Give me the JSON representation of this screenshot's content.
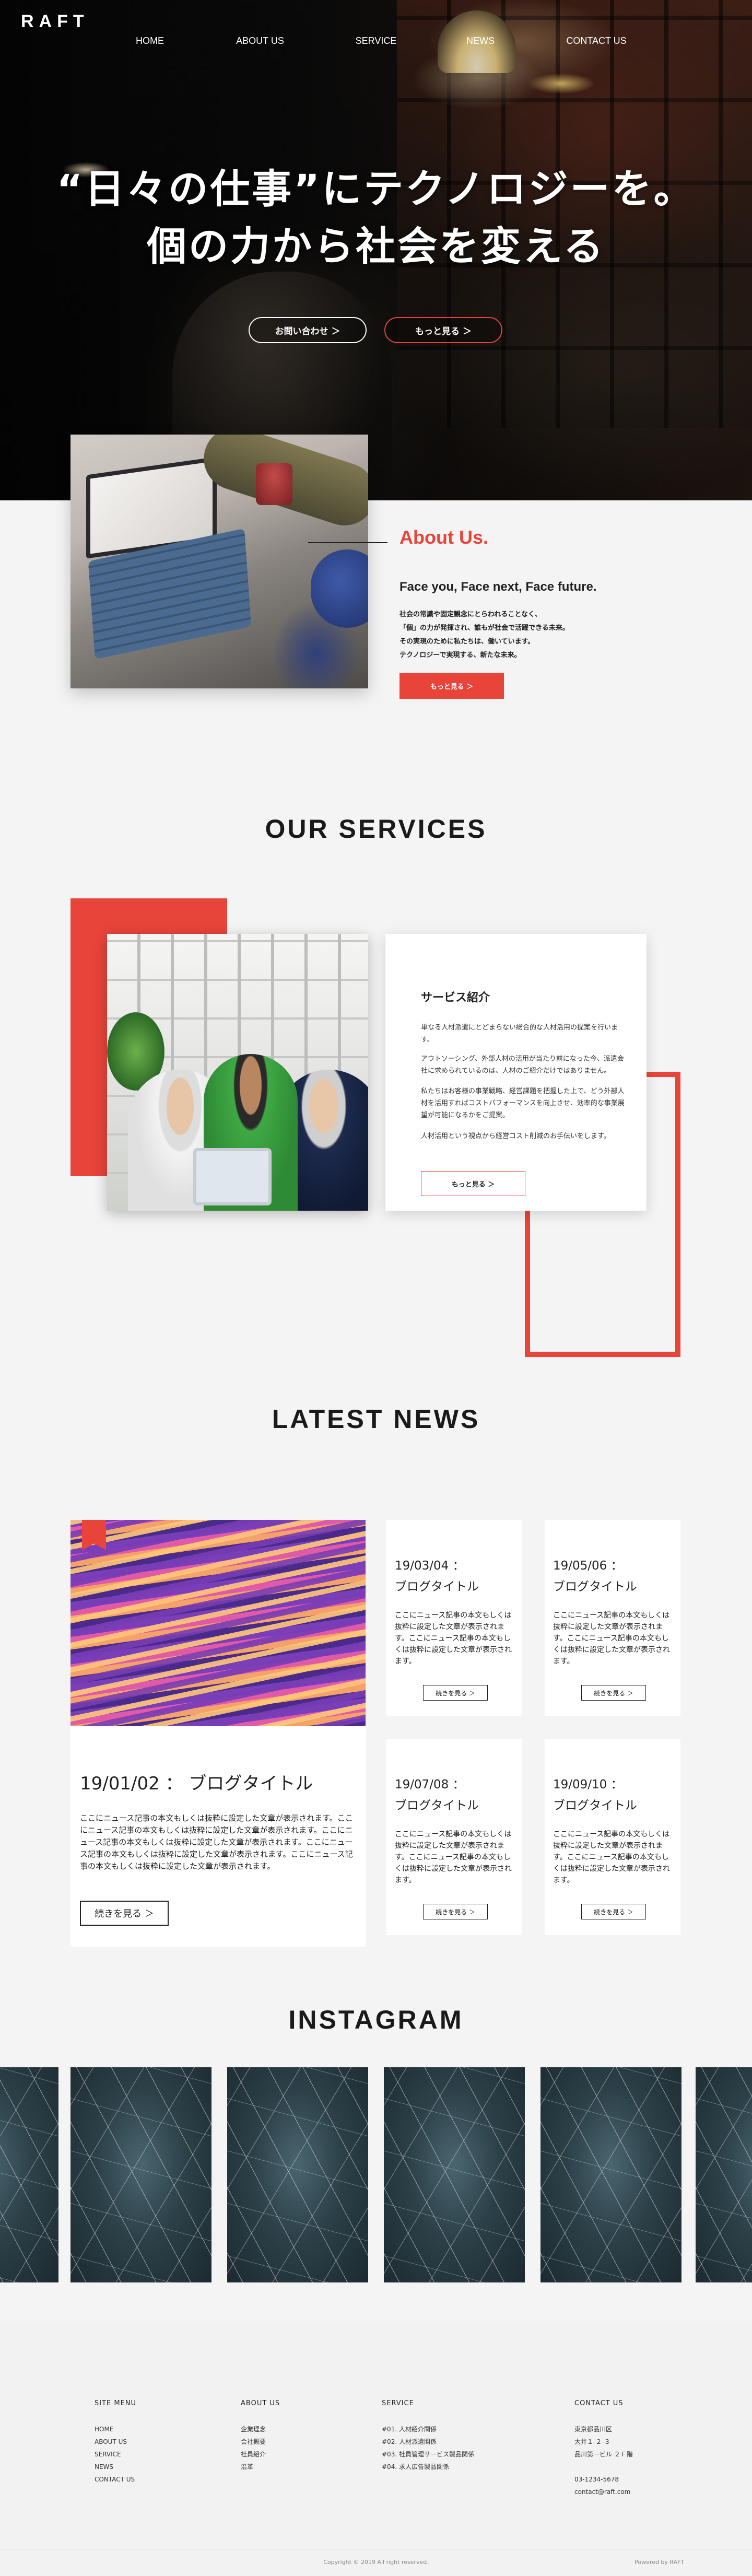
{
  "header": {
    "logo": "RAFT",
    "nav": [
      "HOME",
      "ABOUT US",
      "SERVICE",
      "NEWS",
      "CONTACT US"
    ]
  },
  "hero": {
    "line1": "“日々の仕事”にテクノロジーを。",
    "line2": "個の力から社会を変える",
    "contact_button": "お問い合わせ ＞",
    "more_button": "もっと見る ＞"
  },
  "about": {
    "title": "About Us.",
    "subtitle": "Face you, Face next, Face future.",
    "lines": [
      "社会の常識や固定観念にとらわれることなく、",
      "「個」の力が発揮され、誰もが社会で活躍できる未来。",
      "その実現のために私たちは、働いています。",
      "テクノロジーで実現する、新たな未来。"
    ],
    "button": "もっと見る ＞"
  },
  "services": {
    "section_title": "OUR SERVICES",
    "card_title": "サービス紹介",
    "paragraphs": [
      "単なる人材派遣にとどまらない総合的な人材活用の提案を行います。",
      "アウトソーシング、外部人材の活用が当たり前になった今、派遣会社に求められているのは、人材のご紹介だけではありません。",
      "私たちはお客様の事業戦略、経営課題を把握した上で、どう外部人材を活用すればコストパフォーマンスを向上させ、効率的な事業展望が可能になるかをご提案。",
      "人材活用という視点から経営コスト削減のお手伝いをします。"
    ],
    "button": "もっと見る ＞"
  },
  "news": {
    "section_title": "LATEST NEWS",
    "featured": {
      "date_title": "19/01/02 ： ブログタイトル",
      "body": "ここにニュース記事の本文もしくは抜粋に設定した文章が表示されます。ここにニュース記事の本文もしくは抜粋に設定した文章が表示されます。ここにニュース記事の本文もしくは抜粋に設定した文章が表示されます。ここにニュース記事の本文もしくは抜粋に設定した文章が表示されます。ここにニュース記事の本文もしくは抜粋に設定した文章が表示されます。",
      "more": "続きを見る ＞"
    },
    "cards": [
      {
        "date": "19/03/04 ：",
        "title": "ブログタイトル",
        "body": "ここにニュース記事の本文もしくは抜粋に設定した文章が表示されます。ここにニュース記事の本文もしくは抜粋に設定した文章が表示されます。",
        "more": "続きを見る ＞"
      },
      {
        "date": "19/05/06 ：",
        "title": "ブログタイトル",
        "body": "ここにニュース記事の本文もしくは抜粋に設定した文章が表示されます。ここにニュース記事の本文もしくは抜粋に設定した文章が表示されます。",
        "more": "続きを見る ＞"
      },
      {
        "date": "19/07/08 ：",
        "title": "ブログタイトル",
        "body": "ここにニュース記事の本文もしくは抜粋に設定した文章が表示されます。ここにニュース記事の本文もしくは抜粋に設定した文章が表示されます。",
        "more": "続きを見る ＞"
      },
      {
        "date": "19/09/10 ：",
        "title": "ブログタイトル",
        "body": "ここにニュース記事の本文もしくは抜粋に設定した文章が表示されます。ここにニュース記事の本文もしくは抜粋に設定した文章が表示されます。",
        "more": "続きを見る ＞"
      }
    ]
  },
  "instagram": {
    "section_title": "INSTAGRAM"
  },
  "footer": {
    "site_menu": {
      "title": "SITE MENU",
      "items": [
        "HOME",
        "ABOUT US",
        "SERVICE",
        "NEWS",
        "CONTACT US"
      ]
    },
    "about_us": {
      "title": "ABOUT US",
      "items": [
        "企業理念",
        "会社概要",
        "社員紹介",
        "沿革"
      ]
    },
    "service": {
      "title": "SERVICE",
      "items": [
        "#01. 人材紹介関係",
        "#02. 人材派遣関係",
        "#03. 社員管理サービス製品関係",
        "#04. 求人広告製品関係"
      ]
    },
    "contact": {
      "title": "CONTACT US",
      "lines": [
        "東京都品川区",
        "大井１-２-３",
        "品川第一ビル ２Ｆ階",
        "",
        "03-1234-5678",
        "contact@raft.com"
      ]
    },
    "copyright": "Copyright © 2019 All right reserved.",
    "powered": "Powered by RAFT"
  },
  "colors": {
    "accent": "#e8443a",
    "background": "#f4f4f4",
    "text": "#222222"
  }
}
